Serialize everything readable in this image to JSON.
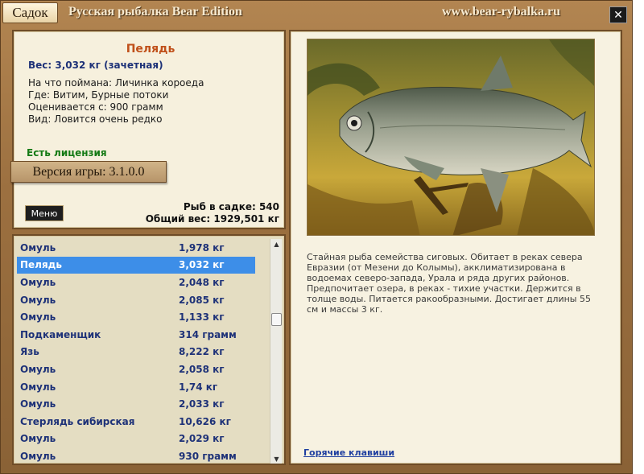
{
  "titlebar": {
    "sadok_label": "Садок",
    "app_title": "Русская рыбалка Bear Edition",
    "url": "www.bear-rybalka.ru",
    "close_label": "✕"
  },
  "fish": {
    "name": "Пелядь",
    "weight_line": "Вес: 3,032 кг (зачетная)",
    "details": [
      "На что поймана: Личинка короеда",
      "Где: Витим, Бурные потоки",
      "Оценивается с: 900 грамм",
      "Вид: Ловится очень редко"
    ],
    "license": "Есть лицензия"
  },
  "version": "Версия игры: 3.1.0.0",
  "menu_label": "Меню",
  "stats": {
    "count_line": "Рыб в садке: 540",
    "total_line": "Общий вес: 1929,501 кг"
  },
  "catch_list": [
    {
      "name": "Омуль",
      "weight": "1,978 кг",
      "selected": false
    },
    {
      "name": "Пелядь",
      "weight": "3,032 кг",
      "selected": true
    },
    {
      "name": "Омуль",
      "weight": "2,048 кг",
      "selected": false
    },
    {
      "name": "Омуль",
      "weight": "2,085 кг",
      "selected": false
    },
    {
      "name": "Омуль",
      "weight": "1,133 кг",
      "selected": false
    },
    {
      "name": "Подкаменщик",
      "weight": "314 грамм",
      "selected": false
    },
    {
      "name": "Язь",
      "weight": "8,222 кг",
      "selected": false
    },
    {
      "name": "Омуль",
      "weight": "2,058 кг",
      "selected": false
    },
    {
      "name": "Омуль",
      "weight": "1,74 кг",
      "selected": false
    },
    {
      "name": "Омуль",
      "weight": "2,033 кг",
      "selected": false
    },
    {
      "name": "Стерлядь сибирская",
      "weight": "10,626 кг",
      "selected": false
    },
    {
      "name": "Омуль",
      "weight": "2,029 кг",
      "selected": false
    },
    {
      "name": "Омуль",
      "weight": "930 грамм",
      "selected": false
    }
  ],
  "description": "Стайная рыба семейства сиговых. Обитает в реках севера Евразии (от Мезени до Колымы), акклиматизирована в водоемах северо-запада, Урала и ряда других районов. Предпочитает озера, в реках - тихие участки. Держится в толще воды. Питается ракообразными. Достигает длины 55 см и массы 3 кг.",
  "hotkeys_label": "Горячие клавиши",
  "colors": {
    "frame": "#9c7040",
    "selected_row": "#3d8ee8",
    "fish_name": "#c0501a",
    "list_text": "#1e3278",
    "license": "#147a14"
  }
}
